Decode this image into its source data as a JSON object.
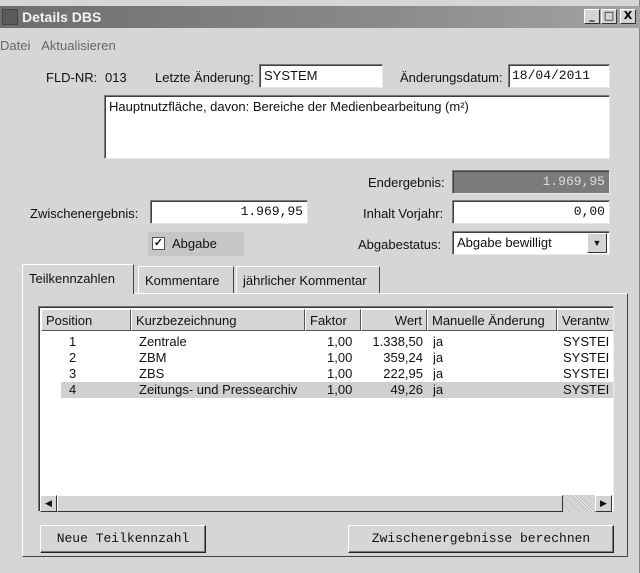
{
  "window": {
    "title": "Details DBS",
    "minimize": "_",
    "maximize": "□",
    "close": "X"
  },
  "menu": [
    "Datei",
    "Aktualisieren"
  ],
  "form": {
    "fld_nr_label": "FLD-NR:",
    "fld_nr_value": "013",
    "last_change_label": "Letzte Änderung:",
    "last_change_value": "SYSTEM",
    "change_date_label": "Änderungsdatum:",
    "change_date_value": "18/04/2011",
    "description": "Hauptnutzfläche, davon: Bereiche der Medienbearbeitung (m²)",
    "endergebnis_label": "Endergebnis:",
    "endergebnis_value": "1.969,95",
    "zwischenergebnis_label": "Zwischenergebnis:",
    "zwischenergebnis_value": "1.969,95",
    "inhalt_vorjahr_label": "Inhalt Vorjahr:",
    "inhalt_vorjahr_value": "0,00",
    "abgabe_label": "Abgabe",
    "abgabe_checked": true,
    "abgabestatus_label": "Abgabestatus:",
    "abgabestatus_value": "Abgabe bewilligt"
  },
  "tabs": [
    "Teilkennzahlen",
    "Kommentare",
    "jährlicher Kommentar"
  ],
  "table": {
    "columns": [
      "Position",
      "Kurzbezeichnung",
      "Faktor",
      "Wert",
      "Manuelle Änderung",
      "Verantw"
    ],
    "rows": [
      [
        "1",
        "Zentrale",
        "1,00",
        "1.338,50",
        "ja",
        "SYSTEI"
      ],
      [
        "2",
        "ZBM",
        "1,00",
        "359,24",
        "ja",
        "SYSTEI"
      ],
      [
        "3",
        "ZBS",
        "1,00",
        "222,95",
        "ja",
        "SYSTEI"
      ],
      [
        "4",
        "Zeitungs- und Pressearchiv",
        "1,00",
        "49,26",
        "ja",
        "SYSTEI"
      ]
    ],
    "selected_row": 4
  },
  "buttons": {
    "new": "Neue Teilkennzahl",
    "compute": "Zwischenergebnisse berechnen"
  }
}
